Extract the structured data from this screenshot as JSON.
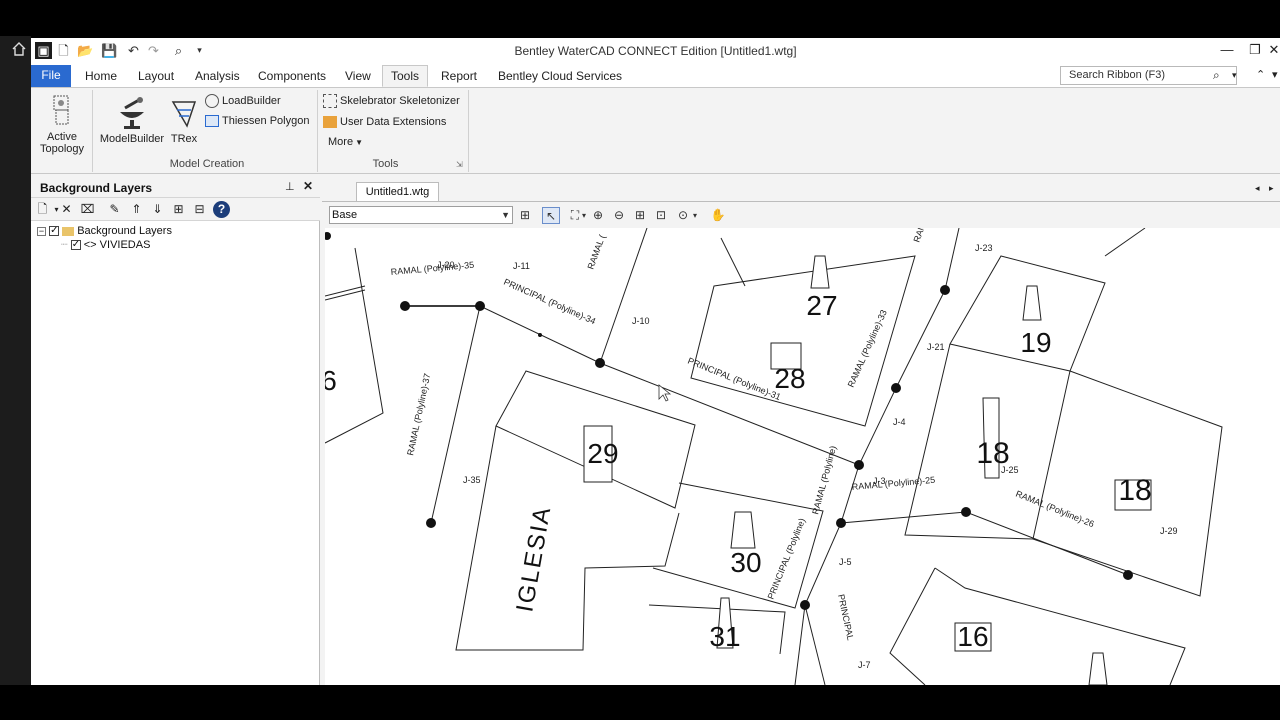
{
  "app": {
    "title": "Bentley WaterCAD CONNECT Edition [Untitled1.wtg]"
  },
  "quick_access": {
    "undo_icon": "undo-icon",
    "redo_icon": "redo-icon"
  },
  "window_controls": {
    "minimize": "—",
    "restore": "❐",
    "close": "✕"
  },
  "ribbon_tabs": [
    "File",
    "Home",
    "Layout",
    "Analysis",
    "Components",
    "View",
    "Tools",
    "Report",
    "Bentley Cloud Services"
  ],
  "active_tab": "Tools",
  "search": {
    "placeholder": "Search Ribbon (F3)"
  },
  "ribbon": {
    "active_topology": {
      "line1": "Active",
      "line2": "Topology"
    },
    "modelbuilder": "ModelBuilder",
    "trex": "TRex",
    "loadbuilder": "LoadBuilder",
    "thiessen": "Thiessen Polygon",
    "group_model_creation": "Model Creation",
    "skelebrator": "Skelebrator Skeletonizer",
    "user_data": "User Data Extensions",
    "more": "More",
    "group_tools": "Tools"
  },
  "background_layers": {
    "title": "Background Layers",
    "root": "Background Layers",
    "child": "VIVIEDAS"
  },
  "document": {
    "tab": "Untitled1.wtg",
    "scenario": "Base"
  },
  "map": {
    "lots": [
      "27",
      "28",
      "29",
      "19",
      "18",
      "18",
      "30",
      "31",
      "16",
      "6"
    ],
    "church": "IGLESIA",
    "junctions": [
      "J-20",
      "J-11",
      "J-10",
      "J-23",
      "J-21",
      "J-4",
      "J-25",
      "J-35",
      "J-3",
      "J-5",
      "J-29",
      "J-7"
    ],
    "pipes": [
      "RAMAL (Polyline)-35",
      "PRINCIPAL (Polyline)-34",
      "PRINCIPAL (Polyline)-31",
      "RAMAL (Polyline)-37",
      "RAMAL (Polyline)-25",
      "RAMAL (Polyline)-26",
      "PRINCIPAL (Polyline)",
      "RAMAL (Polyline)",
      "PRINCIPAL",
      "RAMAL (",
      "RAMAL",
      "RAMAL (Polyline)-33"
    ]
  }
}
